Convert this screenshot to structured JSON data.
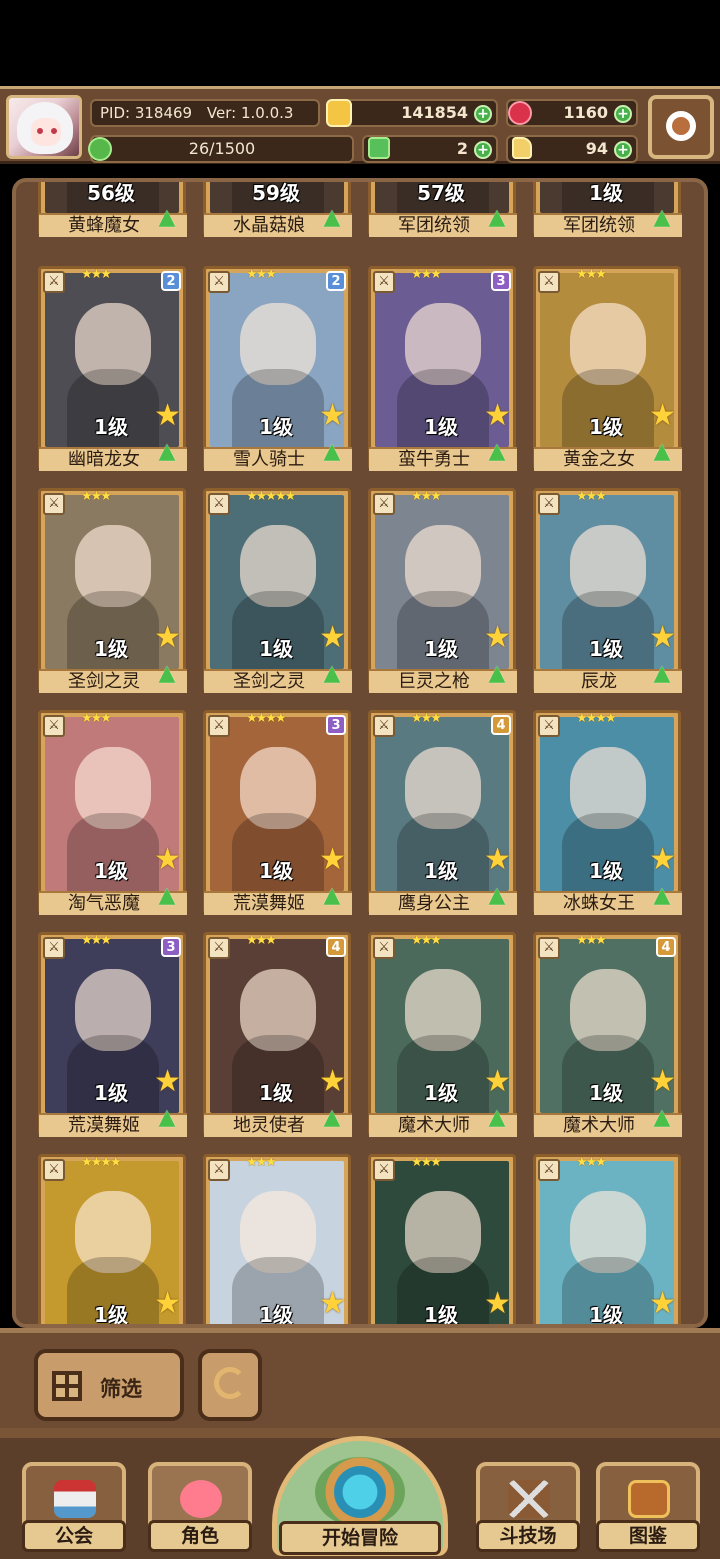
{
  "header": {
    "pid_label": "PID: 318469",
    "version_label": "Ver: 1.0.0.3",
    "coins": "141854",
    "gems": "1160",
    "energy": "26/1500",
    "clover": "2",
    "horn": "94"
  },
  "top_row": [
    {
      "level": "56级",
      "name": "黄蜂魔女"
    },
    {
      "level": "59级",
      "name": "水晶菇娘"
    },
    {
      "level": "57级",
      "name": "军团统领"
    },
    {
      "level": "1级",
      "name": "军团统领"
    }
  ],
  "cards": [
    {
      "level": "1级",
      "name": "幽暗龙女",
      "stars": "★★★",
      "rank": "2",
      "rank_color": "#5a8fd8",
      "art": "#4e4d54"
    },
    {
      "level": "1级",
      "name": "雪人骑士",
      "stars": "★★★",
      "rank": "2",
      "rank_color": "#5a8fd8",
      "art": "#8aa5c2"
    },
    {
      "level": "1级",
      "name": "蛮牛勇士",
      "stars": "★★★",
      "rank": "3",
      "rank_color": "#8e5fc2",
      "art": "#6b5d93"
    },
    {
      "level": "1级",
      "name": "黄金之女",
      "stars": "★★★",
      "rank": "",
      "rank_color": "",
      "art": "#b48c3e"
    },
    {
      "level": "1级",
      "name": "圣剑之灵",
      "stars": "★★★",
      "rank": "",
      "rank_color": "",
      "art": "#8b7a62"
    },
    {
      "level": "1级",
      "name": "圣剑之灵",
      "stars": "★★★★★",
      "rank": "",
      "rank_color": "",
      "art": "#4d6e76"
    },
    {
      "level": "1级",
      "name": "巨灵之枪",
      "stars": "★★★",
      "rank": "",
      "rank_color": "",
      "art": "#7d8591"
    },
    {
      "level": "1级",
      "name": "辰龙",
      "stars": "★★★",
      "rank": "",
      "rank_color": "",
      "art": "#5f8ea2"
    },
    {
      "level": "1级",
      "name": "淘气恶魔",
      "stars": "★★★",
      "rank": "",
      "rank_color": "",
      "art": "#c07a7a"
    },
    {
      "level": "1级",
      "name": "荒漠舞姬",
      "stars": "★★★★",
      "rank": "3",
      "rank_color": "#8e5fc2",
      "art": "#a4653b"
    },
    {
      "level": "1级",
      "name": "鹰身公主",
      "stars": "★★★",
      "rank": "4",
      "rank_color": "#d49a3a",
      "art": "#5a7a82"
    },
    {
      "level": "1级",
      "name": "冰蛛女王",
      "stars": "★★★★",
      "rank": "",
      "rank_color": "",
      "art": "#4d8ea7"
    },
    {
      "level": "1级",
      "name": "荒漠舞姬",
      "stars": "★★★",
      "rank": "3",
      "rank_color": "#8e5fc2",
      "art": "#3e3d5a"
    },
    {
      "level": "1级",
      "name": "地灵使者",
      "stars": "★★★",
      "rank": "4",
      "rank_color": "#d49a3a",
      "art": "#5a3f36"
    },
    {
      "level": "1级",
      "name": "魔术大师",
      "stars": "★★★",
      "rank": "",
      "rank_color": "",
      "art": "#4b6a5c"
    },
    {
      "level": "1级",
      "name": "魔术大师",
      "stars": "★★★",
      "rank": "4",
      "rank_color": "#d49a3a",
      "art": "#4f7062"
    },
    {
      "level": "1级",
      "name": "",
      "stars": "★★★★",
      "rank": "",
      "rank_color": "",
      "art": "#c49a2f"
    },
    {
      "level": "1级",
      "name": "",
      "stars": "★★★",
      "rank": "",
      "rank_color": "",
      "art": "#c7d3de"
    },
    {
      "level": "1级",
      "name": "",
      "stars": "★★★",
      "rank": "",
      "rank_color": "",
      "art": "#2e4a3c"
    },
    {
      "level": "1级",
      "name": "",
      "stars": "★★★",
      "rank": "",
      "rank_color": "",
      "art": "#6bb3c3"
    }
  ],
  "controls": {
    "filter_label": "筛选"
  },
  "nav": {
    "guild": "公会",
    "role": "角色",
    "adventure": "开始冒险",
    "arena": "斗技场",
    "codex": "图鉴"
  }
}
